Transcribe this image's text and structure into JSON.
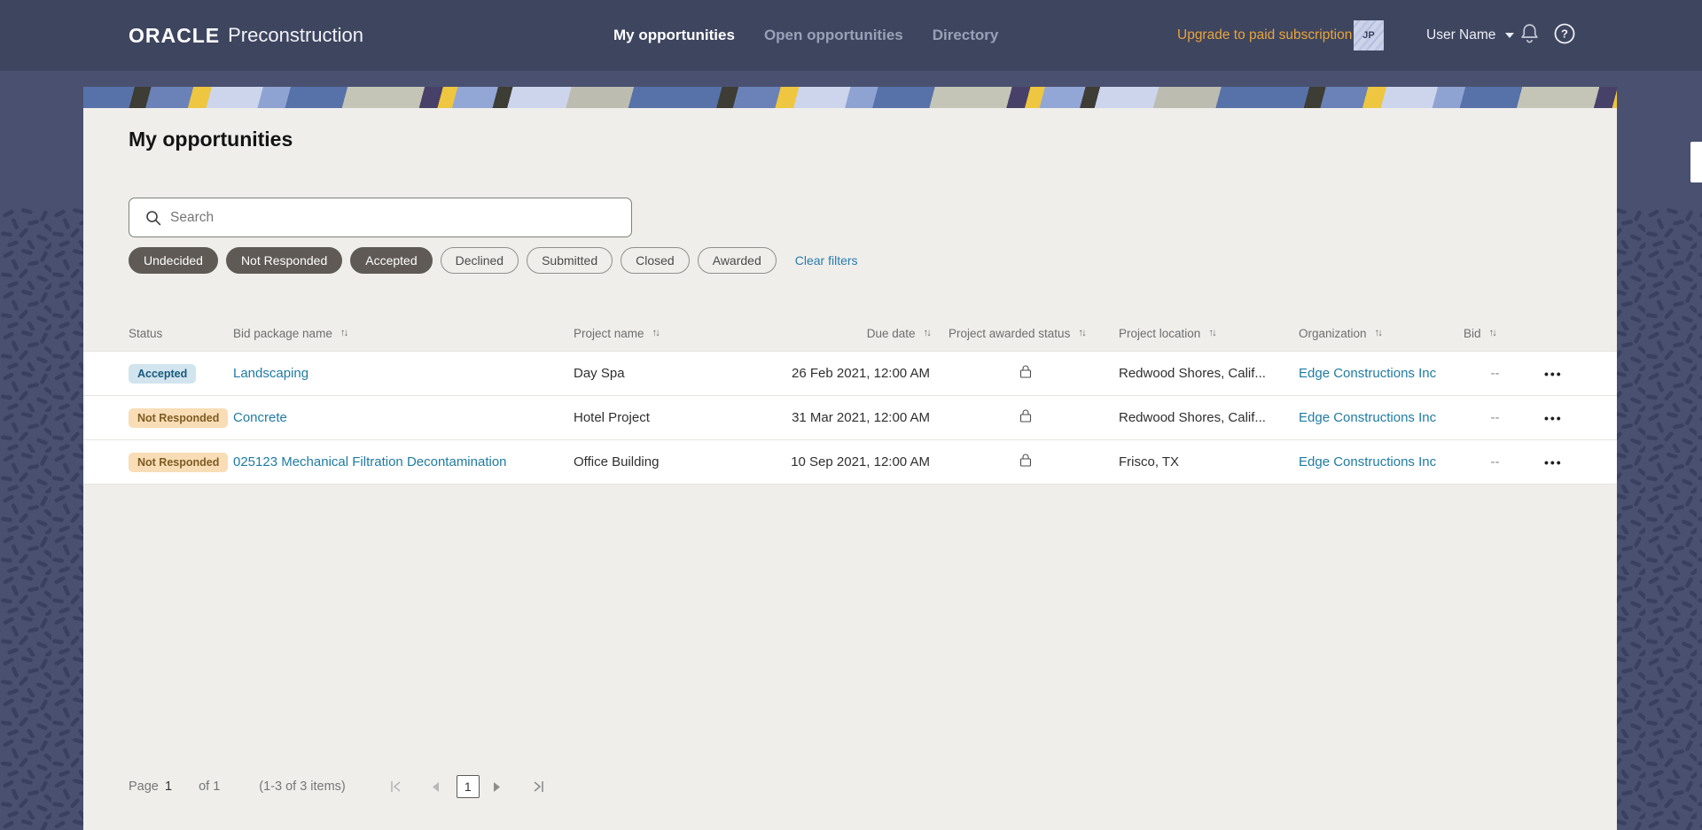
{
  "header": {
    "brand": {
      "logo": "ORACLE",
      "product": "Preconstruction"
    },
    "nav": [
      {
        "label": "My opportunities",
        "active": true
      },
      {
        "label": "Open opportunities",
        "active": false
      },
      {
        "label": "Directory",
        "active": false
      }
    ],
    "upgrade_link": "Upgrade to paid subscription",
    "avatar_initials": "JP",
    "user_name": "User Name",
    "icons": [
      "notification-bell-icon",
      "help-icon",
      "chevron-down-icon"
    ]
  },
  "page": {
    "title": "My opportunities",
    "search_placeholder": "Search",
    "filters": {
      "pills": [
        {
          "label": "Undecided",
          "selected": true
        },
        {
          "label": "Not Responded",
          "selected": true
        },
        {
          "label": "Accepted",
          "selected": true
        },
        {
          "label": "Declined",
          "selected": false
        },
        {
          "label": "Submitted",
          "selected": false
        },
        {
          "label": "Closed",
          "selected": false
        },
        {
          "label": "Awarded",
          "selected": false
        }
      ],
      "clear_label": "Clear filters"
    }
  },
  "table": {
    "columns": [
      {
        "label": "Status",
        "sortable": false
      },
      {
        "label": "Bid package name",
        "sortable": true
      },
      {
        "label": "Project name",
        "sortable": true
      },
      {
        "label": "Due date",
        "sortable": true
      },
      {
        "label": "Project awarded status",
        "sortable": true
      },
      {
        "label": "Project location",
        "sortable": true
      },
      {
        "label": "Organization",
        "sortable": true
      },
      {
        "label": "Bid",
        "sortable": true
      },
      {
        "label": "",
        "sortable": false
      }
    ],
    "rows": [
      {
        "status": "Accepted",
        "status_variant": "accepted",
        "bid_package_name": "Landscaping",
        "project_name": "Day Spa",
        "due_date": "26 Feb 2021, 12:00 AM",
        "project_awarded_status_icon": "lock-icon",
        "project_location": "Redwood Shores, Calif...",
        "organization": "Edge Constructions Inc",
        "bid": "--"
      },
      {
        "status": "Not Responded",
        "status_variant": "not-responded",
        "bid_package_name": "Concrete",
        "project_name": "Hotel Project",
        "due_date": "31 Mar 2021, 12:00 AM",
        "project_awarded_status_icon": "lock-icon",
        "project_location": "Redwood Shores, Calif...",
        "organization": "Edge Constructions Inc",
        "bid": "--"
      },
      {
        "status": "Not Responded",
        "status_variant": "not-responded",
        "bid_package_name": "025123 Mechanical Filtration Decontamination",
        "project_name": "Office Building",
        "due_date": "10 Sep 2021, 12:00 AM",
        "project_awarded_status_icon": "lock-icon",
        "project_location": "Frisco, TX",
        "organization": "Edge Constructions Inc",
        "bid": "--"
      }
    ]
  },
  "glyphs": {
    "sort": "↑↓",
    "ellipsis": "•••"
  },
  "pagination": {
    "page_label": "Page",
    "current_page": "1",
    "total_label": "of 1",
    "items_summary": "(1-3 of 3 items)",
    "page_button": "1"
  },
  "colors": {
    "header_bg": "#3e455f",
    "side_band_bg": "#4a5170",
    "pattern_dash": "#3a4060",
    "content_bg": "#efeeeb",
    "accent_orange": "#e8a43c",
    "link": "#1e7ba2",
    "clear_filters_link": "#2a7cab",
    "pill_selected_bg": "#5f5a55",
    "badge_accepted_bg": "#d2e4ee",
    "badge_accepted_text": "#175a7d",
    "badge_not_responded_bg": "#f8ddb6",
    "badge_not_responded_text": "#7d5b22"
  }
}
